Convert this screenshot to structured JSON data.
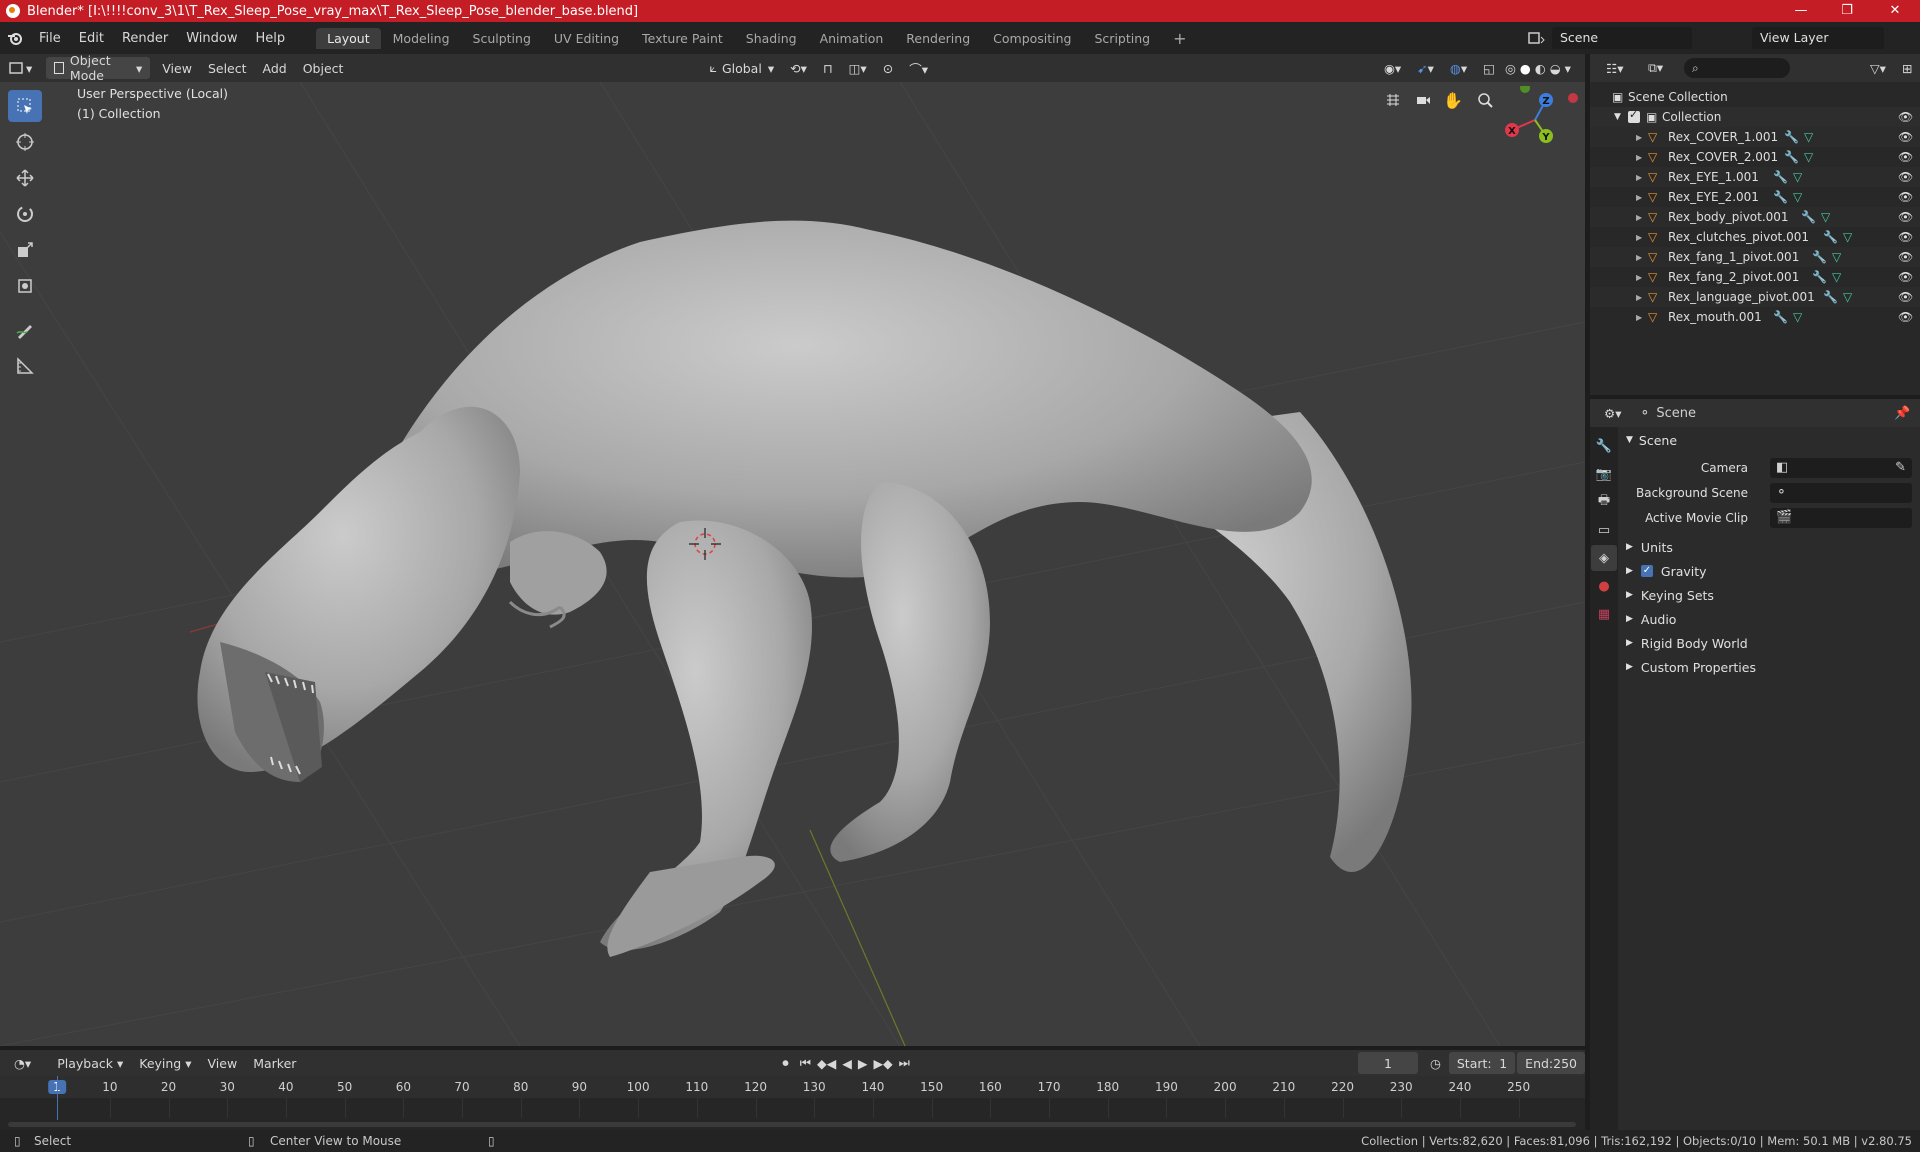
{
  "window": {
    "title": "Blender* [I:\\!!!!conv_3\\1\\T_Rex_Sleep_Pose_vray_max\\T_Rex_Sleep_Pose_blender_base.blend]",
    "minimize": "—",
    "maximize": "❐",
    "close": "✕"
  },
  "menu": [
    "File",
    "Edit",
    "Render",
    "Window",
    "Help"
  ],
  "workspaces": [
    "Layout",
    "Modeling",
    "Sculpting",
    "UV Editing",
    "Texture Paint",
    "Shading",
    "Animation",
    "Rendering",
    "Compositing",
    "Scripting"
  ],
  "active_workspace": "Layout",
  "scene_name": "Scene",
  "view_layer": "View Layer",
  "viewport_header": {
    "mode": "Object Mode",
    "menus": [
      "View",
      "Select",
      "Add",
      "Object"
    ],
    "orientation": "Global"
  },
  "viewport": {
    "perspective_label": "User Perspective (Local)",
    "collection_label": "(1) Collection",
    "gizmo": {
      "x": "X",
      "y": "Y",
      "z": "Z"
    }
  },
  "outliner": {
    "root": "Scene Collection",
    "collection": "Collection",
    "items": [
      "Rex_COVER_1.001",
      "Rex_COVER_2.001",
      "Rex_EYE_1.001",
      "Rex_EYE_2.001",
      "Rex_body_pivot.001",
      "Rex_clutches_pivot.001",
      "Rex_fang_1_pivot.001",
      "Rex_fang_2_pivot.001",
      "Rex_language_pivot.001",
      "Rex_mouth.001"
    ]
  },
  "properties": {
    "header": "Scene",
    "panel": "Scene",
    "fields": {
      "camera": "Camera",
      "background_scene": "Background Scene",
      "active_movie_clip": "Active Movie Clip"
    },
    "sections": [
      "Units",
      "Gravity",
      "Keying Sets",
      "Audio",
      "Rigid Body World",
      "Custom Properties"
    ],
    "gravity_checked": true
  },
  "timeline": {
    "menus": [
      "Playback",
      "Keying",
      "View",
      "Marker"
    ],
    "current_frame": "1",
    "start_label": "Start:",
    "start": "1",
    "end_label": "End:",
    "end": "250",
    "ticks": [
      "1",
      "10",
      "20",
      "30",
      "40",
      "50",
      "60",
      "70",
      "80",
      "90",
      "100",
      "110",
      "120",
      "130",
      "140",
      "150",
      "160",
      "170",
      "180",
      "190",
      "200",
      "210",
      "220",
      "230",
      "240",
      "250"
    ]
  },
  "status": {
    "select": "Select",
    "center": "Center View to Mouse",
    "stats": "Collection | Verts:82,620 | Faces:81,096 | Tris:162,192 | Objects:0/10 | Mem: 50.1 MB | v2.80.75"
  },
  "colors": {
    "title_red": "#c41d25",
    "accent_blue": "#4772b3",
    "mesh_orange": "#e8922c",
    "axis_x": "#e0384a",
    "axis_y": "#8bbf1f",
    "axis_z": "#3b7ee0"
  }
}
